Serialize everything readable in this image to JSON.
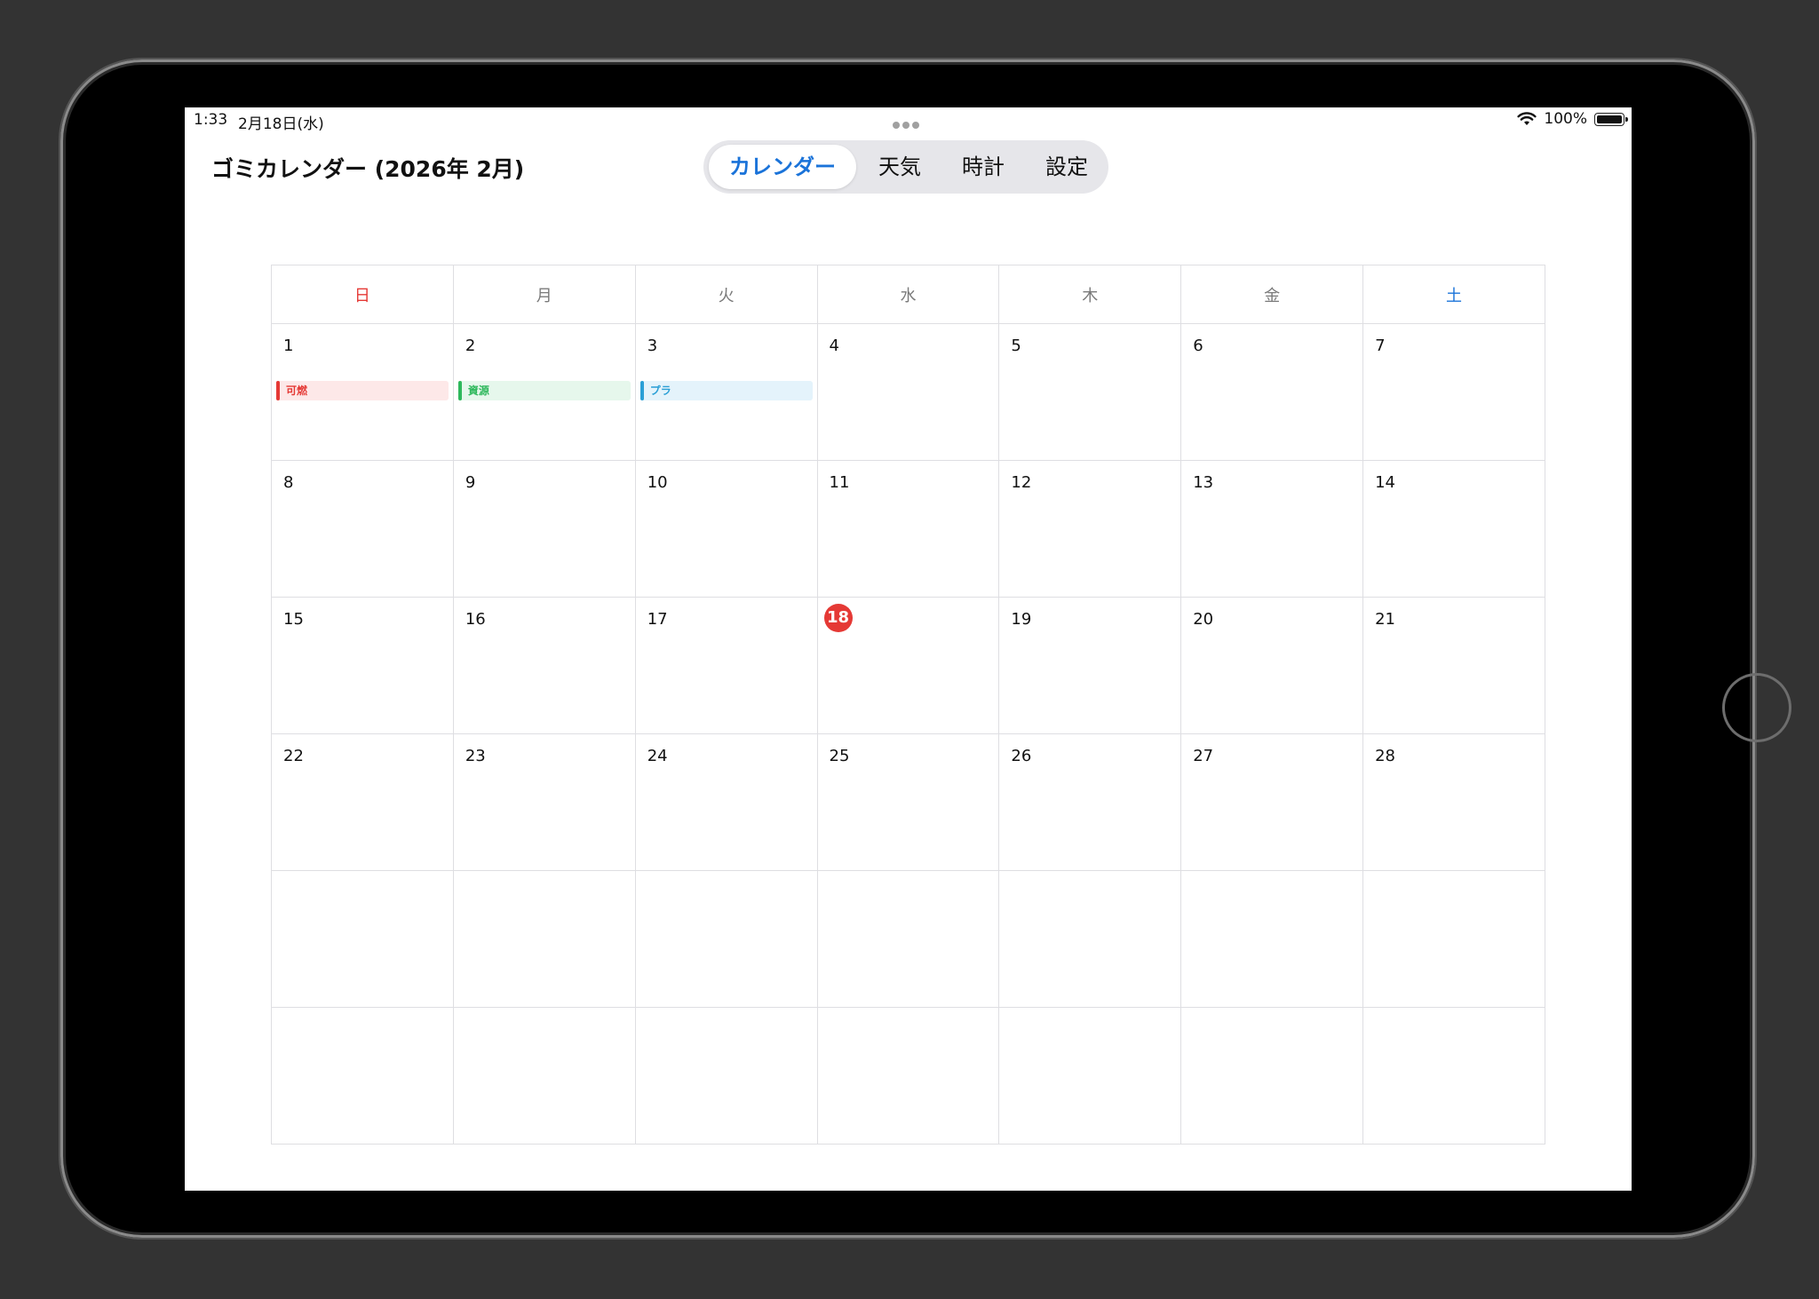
{
  "status_bar": {
    "time": "1:33",
    "date": "2月18日(水)",
    "battery": "100%"
  },
  "header": {
    "title": "ゴミカレンダー (2026年 2月)"
  },
  "tabs": [
    {
      "label": "カレンダー",
      "active": true
    },
    {
      "label": "天気",
      "active": false
    },
    {
      "label": "時計",
      "active": false
    },
    {
      "label": "設定",
      "active": false
    }
  ],
  "calendar": {
    "weekdays": [
      "日",
      "月",
      "火",
      "水",
      "木",
      "金",
      "土"
    ],
    "weeks": [
      [
        "1",
        "2",
        "3",
        "4",
        "5",
        "6",
        "7"
      ],
      [
        "8",
        "9",
        "10",
        "11",
        "12",
        "13",
        "14"
      ],
      [
        "15",
        "16",
        "17",
        "18",
        "19",
        "20",
        "21"
      ],
      [
        "22",
        "23",
        "24",
        "25",
        "26",
        "27",
        "28"
      ],
      [
        "",
        "",
        "",
        "",
        "",
        "",
        ""
      ],
      [
        "",
        "",
        "",
        "",
        "",
        "",
        ""
      ]
    ],
    "today": "18",
    "events": [
      {
        "day": "1",
        "label": "可燃",
        "color": "#e53935",
        "bg": "#fde8e8"
      },
      {
        "day": "2",
        "label": "資源",
        "color": "#2eb85c",
        "bg": "#e6f7ec"
      },
      {
        "day": "3",
        "label": "プラ",
        "color": "#2a9fd6",
        "bg": "#e4f3fb"
      }
    ]
  },
  "colors": {
    "accent": "#1a73d9",
    "sunday": "#e53935",
    "saturday": "#1a73d9",
    "today": "#e53935"
  }
}
